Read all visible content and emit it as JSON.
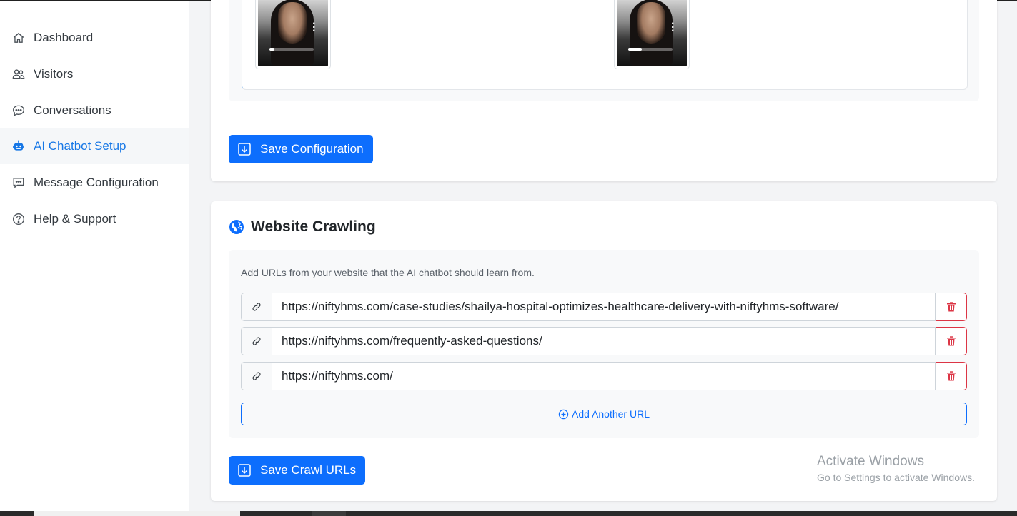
{
  "sidebar": {
    "items": [
      {
        "label": "Dashboard",
        "icon": "home-icon",
        "active": false
      },
      {
        "label": "Visitors",
        "icon": "users-icon",
        "active": false
      },
      {
        "label": "Conversations",
        "icon": "chat-icon",
        "active": false
      },
      {
        "label": "AI Chatbot Setup",
        "icon": "robot-icon",
        "active": true
      },
      {
        "label": "Message Configuration",
        "icon": "message-config-icon",
        "active": false
      },
      {
        "label": "Help & Support",
        "icon": "help-icon",
        "active": false
      }
    ]
  },
  "media": {
    "videos": [
      {
        "progress": 0.12
      },
      {
        "progress": 0.3
      }
    ]
  },
  "config": {
    "save_label": "Save Configuration"
  },
  "crawl": {
    "title": "Website Crawling",
    "description": "Add URLs from your website that the AI chatbot should learn from.",
    "urls": [
      "https://niftyhms.com/case-studies/shailya-hospital-optimizes-healthcare-delivery-with-niftyhms-software/",
      "https://niftyhms.com/frequently-asked-questions/",
      "https://niftyhms.com/"
    ],
    "add_label": "Add Another URL",
    "save_label": "Save Crawl URLs"
  },
  "watermark": {
    "line1": "Activate Windows",
    "line2": "Go to Settings to activate Windows."
  },
  "colors": {
    "primary": "#0d6efd",
    "active_nav": "#1677e6",
    "danger": "#dc3545"
  }
}
